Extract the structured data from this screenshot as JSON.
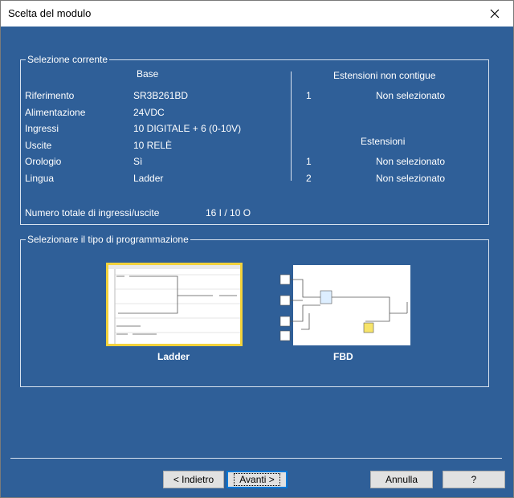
{
  "window": {
    "title": "Scelta del modulo"
  },
  "current_selection": {
    "legend": "Selezione corrente",
    "base_header": "Base",
    "rows": [
      {
        "label": "Riferimento",
        "value": "SR3B261BD"
      },
      {
        "label": "Alimentazione",
        "value": "24VDC"
      },
      {
        "label": "Ingressi",
        "value": "10 DIGITALE + 6 (0-10V)"
      },
      {
        "label": "Uscite",
        "value": "10 RELÈ"
      },
      {
        "label": "Orologio",
        "value": "Sì"
      },
      {
        "label": "Lingua",
        "value": "Ladder"
      }
    ],
    "non_contiguous_header": "Estensioni non contigue",
    "non_contiguous": [
      {
        "num": "1",
        "value": "Non selezionato"
      }
    ],
    "extensions_header": "Estensioni",
    "extensions": [
      {
        "num": "1",
        "value": "Non selezionato"
      },
      {
        "num": "2",
        "value": "Non selezionato"
      }
    ],
    "total_label": "Numero totale di ingressi/uscite",
    "total_value": "16 I / 10 O"
  },
  "programming": {
    "legend": "Selezionare il tipo di programmazione",
    "ladder_label": "Ladder",
    "fbd_label": "FBD",
    "selected": "Ladder",
    "highlight_color": "#f2d23c"
  },
  "buttons": {
    "back": "< Indietro",
    "next": "Avanti >",
    "cancel": "Annulla",
    "help": "?"
  },
  "colors": {
    "background": "#2f5f98"
  }
}
